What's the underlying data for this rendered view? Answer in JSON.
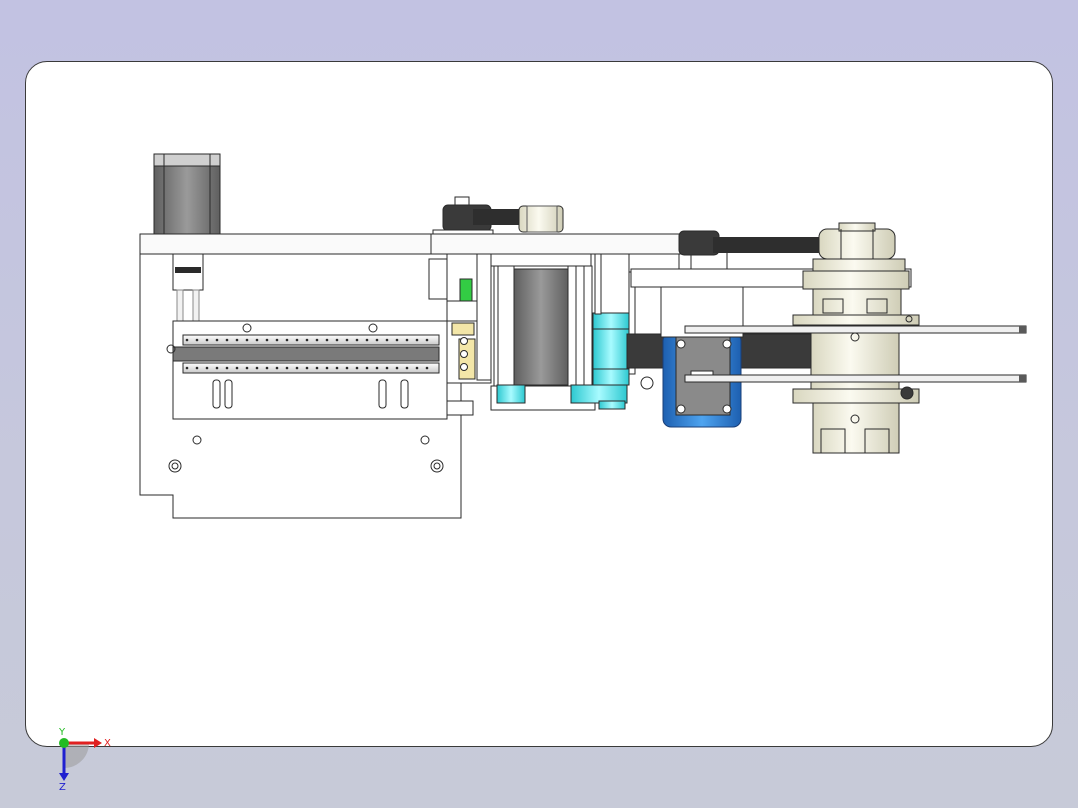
{
  "app": {
    "window": "cad-graphics-viewport",
    "view": "front"
  },
  "triad": {
    "x_label": "X",
    "y_label": "Y",
    "z_label": "Z",
    "colors": {
      "x": "#e02020",
      "y": "#22bb22",
      "z": "#2020d0"
    }
  },
  "model": {
    "colors": {
      "outline": "#2a2a2a",
      "plate": "#ffffff",
      "motor_body": "#8a8a8a",
      "belt": "#2e2e2e",
      "coupling": "#5ee6ea",
      "blue_motor": "#2f7fd6",
      "green_part": "#33cc44",
      "cream_part": "#f2f0dc",
      "yellow_part": "#f3e6a8"
    },
    "parts": [
      "stepper-motor-left",
      "top-frame-rail",
      "linear-slide",
      "base-plate",
      "pulley-assembly-top",
      "center-stepper-motor",
      "cyan-couplings",
      "blue-motor",
      "belt-drive-right",
      "spindle-housing",
      "support-rails-right"
    ]
  }
}
